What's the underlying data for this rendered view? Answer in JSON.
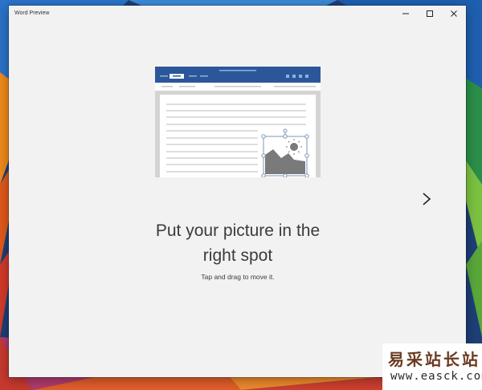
{
  "window": {
    "title": "Word Preview"
  },
  "slide": {
    "heading_line1": "Put your picture in the",
    "heading_line2": "right spot",
    "subtext": "Tap and drag to move it."
  },
  "watermark": {
    "chinese": "易采站长站",
    "url": "www.easck.com"
  },
  "colors": {
    "ribbon_blue": "#2b579a",
    "text": "#3b3b3b",
    "window_bg": "#f2f2f2"
  },
  "icons": [
    "minimize-icon",
    "maximize-icon",
    "close-icon",
    "chevron-right-icon"
  ]
}
